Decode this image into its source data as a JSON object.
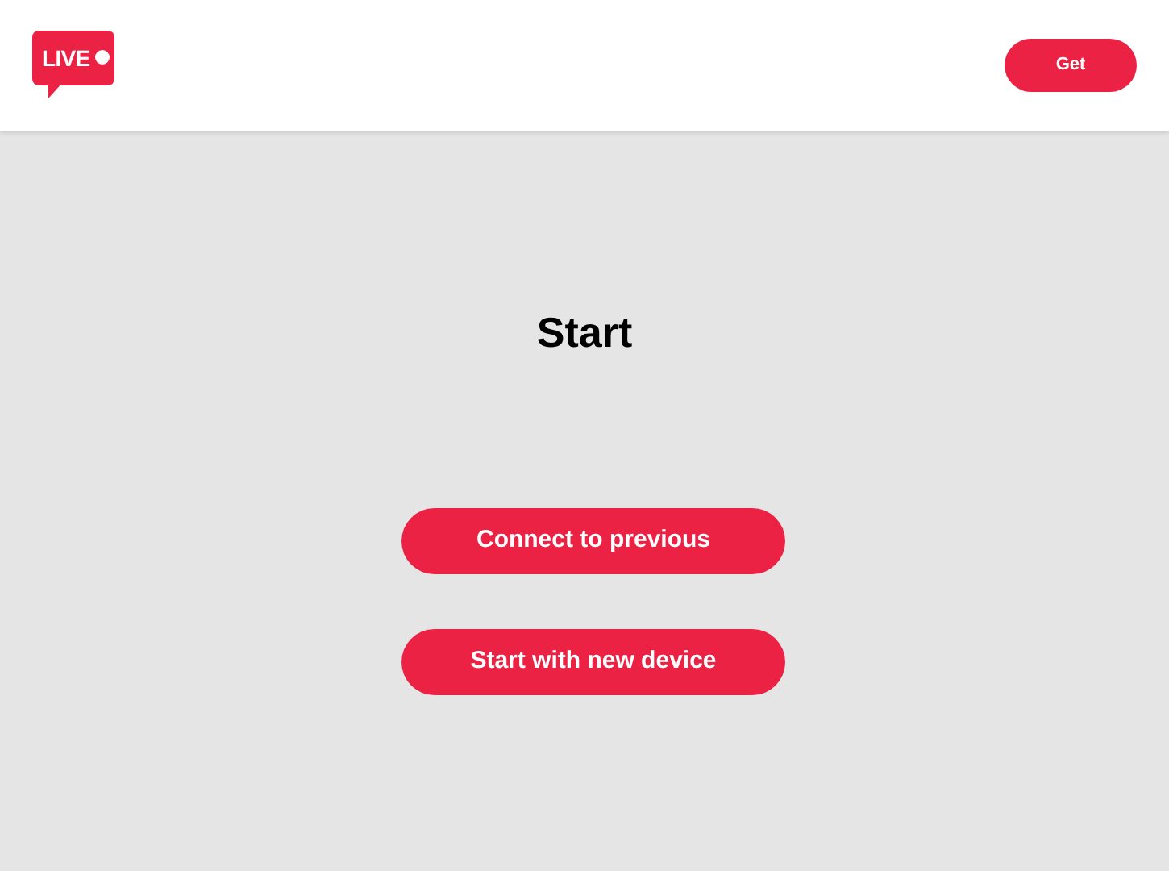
{
  "header": {
    "logo_text": "LIVE",
    "get_button": "Get"
  },
  "main": {
    "title": "Start",
    "buttons": [
      "Connect to previous",
      "Start with new device"
    ]
  }
}
